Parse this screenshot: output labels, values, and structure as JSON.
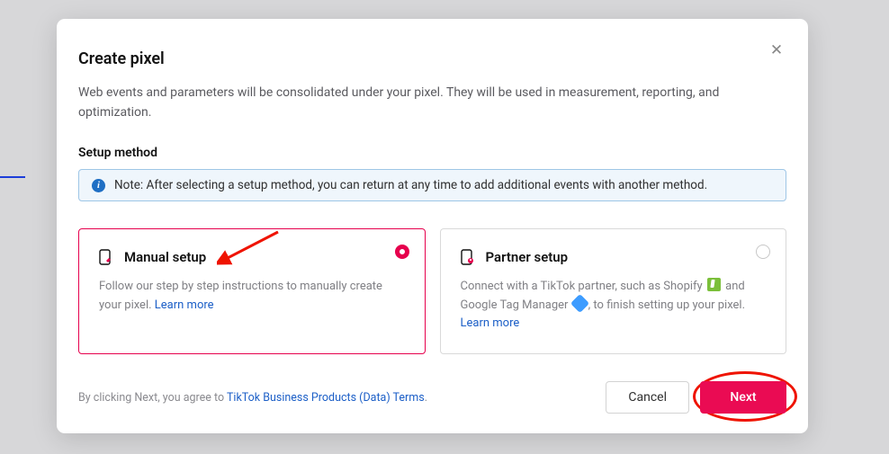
{
  "modal": {
    "title": "Create pixel",
    "subtitle": "Web events and parameters will be consolidated under your pixel. They will be used in measurement, reporting, and optimization.",
    "section_label": "Setup method",
    "info_note": "Note: After selecting a setup method, you can return at any time to add additional events with another method."
  },
  "cards": {
    "manual": {
      "title": "Manual setup",
      "desc": "Follow our step by step instructions to manually create your pixel. ",
      "learn": "Learn more"
    },
    "partner": {
      "title": "Partner setup",
      "desc_pre": "Connect with a TikTok partner, such as Shopify ",
      "desc_mid": " and Google Tag Manager ",
      "desc_post": ", to finish setting up your pixel.",
      "learn": "Learn more"
    }
  },
  "footer": {
    "agree_pre": "By clicking Next, you agree to ",
    "terms_link": "TikTok Business Products (Data) Terms",
    "agree_post": ".",
    "cancel": "Cancel",
    "next": "Next"
  }
}
